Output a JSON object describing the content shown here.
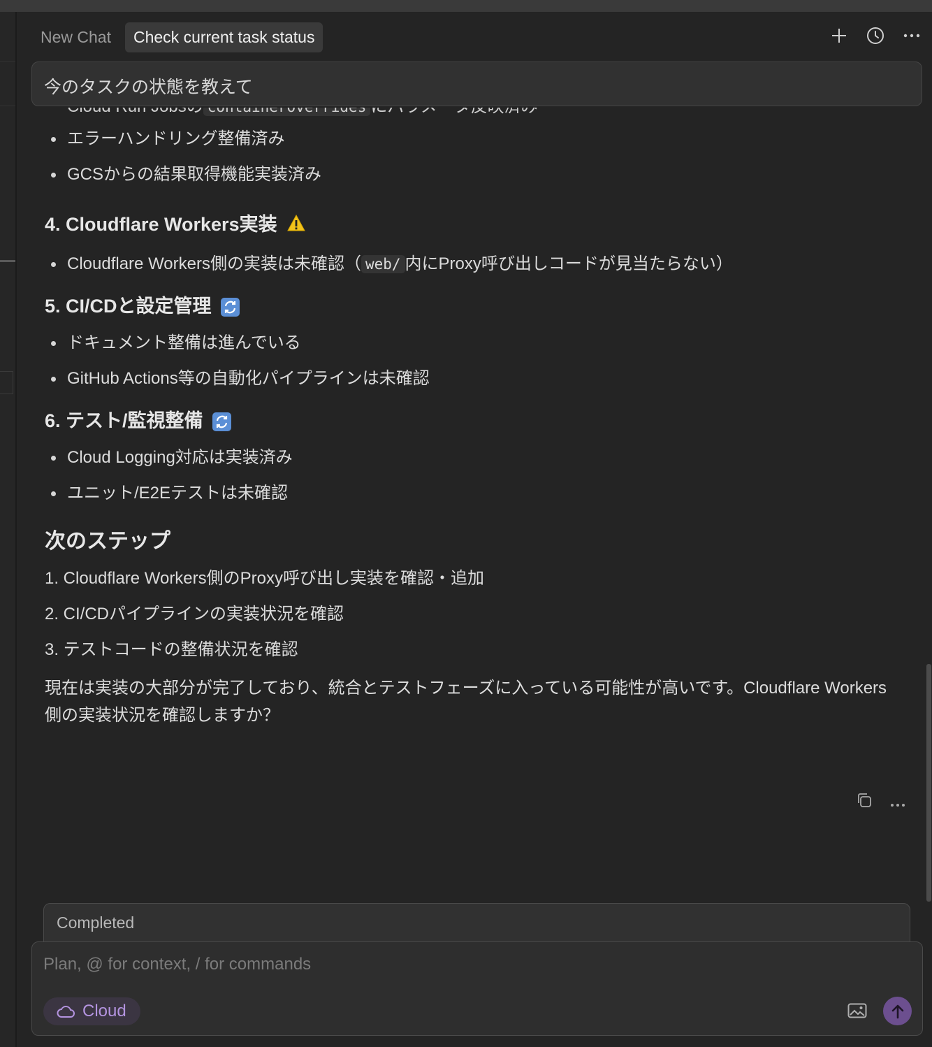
{
  "tabs": [
    {
      "label": "New Chat",
      "active": false
    },
    {
      "label": "Check current task status",
      "active": true
    }
  ],
  "header": {
    "icons": [
      "plus-icon",
      "history-clock-icon",
      "more-dots-icon"
    ]
  },
  "query": "今のタスクの状態を教えて",
  "content": {
    "cut_line": {
      "before": "Cloud Run Jobsの",
      "code": "containerOverrides",
      "after": "にパラメータ反映済み"
    },
    "section3_items": [
      "エラーハンドリング整備済み",
      "GCSからの結果取得機能実装済み"
    ],
    "section4": {
      "title": "4. Cloudflare Workers実装",
      "emoji": "warning-icon",
      "item_before": "Cloudflare Workers側の実装は未確認（",
      "item_code": "web/",
      "item_after": "内にProxy呼び出しコードが見当たらない）"
    },
    "section5": {
      "title": "5. CI/CDと設定管理",
      "emoji": "in-progress-sync-icon",
      "items": [
        "ドキュメント整備は進んでいる",
        "GitHub Actions等の自動化パイプラインは未確認"
      ]
    },
    "section6": {
      "title": "6. テスト/監視整備",
      "emoji": "in-progress-sync-icon",
      "items": [
        "Cloud Logging対応は実装済み",
        "ユニット/E2Eテストは未確認"
      ]
    },
    "next_steps": {
      "title": "次のステップ",
      "items": [
        "1. Cloudflare Workers側のProxy呼び出し実装を確認・追加",
        "2. CI/CDパイプラインの実装状況を確認",
        "3. テストコードの整備状況を確認"
      ]
    },
    "summary": "現在は実装の大部分が完了しており、統合とテストフェーズに入っている可能性が高いです。Cloudflare Workers側の実装状況を確認しますか？"
  },
  "message_actions": [
    "copy-icon",
    "more-dots-icon"
  ],
  "status_bar": {
    "label": "Completed"
  },
  "composer": {
    "placeholder": "Plan, @ for context, / for commands",
    "chip_label": "Cloud",
    "accent_color": "#6c4f8f",
    "chip_text_color": "#b494e0"
  }
}
